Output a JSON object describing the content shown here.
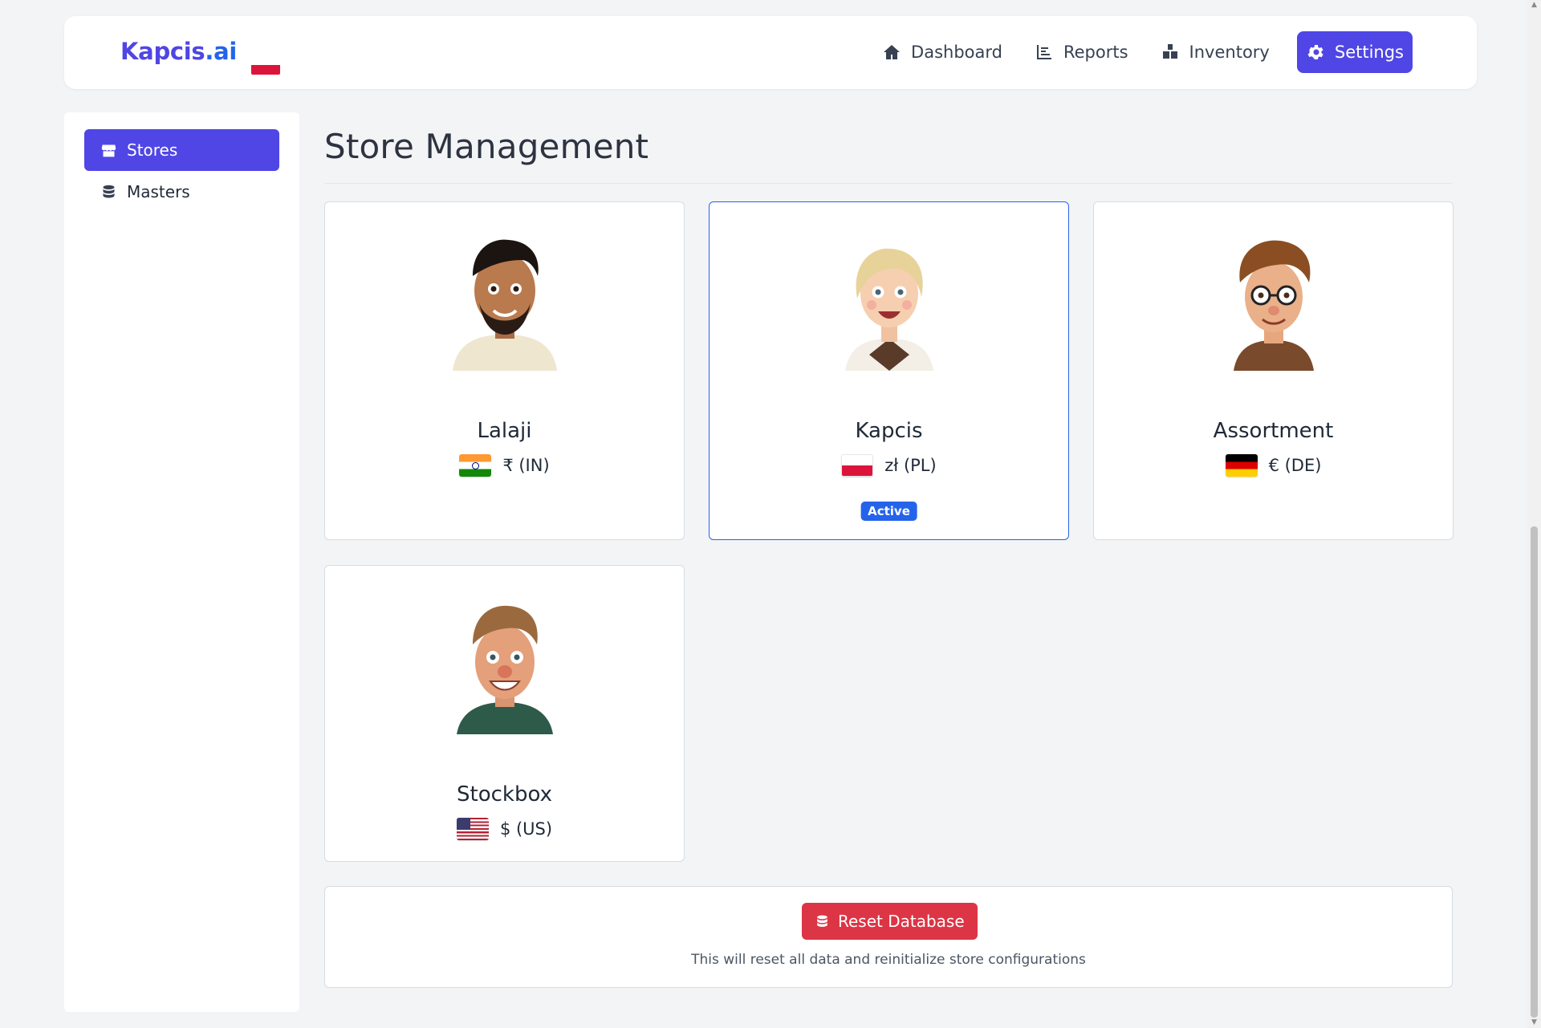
{
  "brand": {
    "name_part1": "Kapcis",
    "name_part2": ".ai",
    "flag_icon": "poland-flag-icon"
  },
  "nav": {
    "items": [
      {
        "label": "Dashboard",
        "icon": "home-icon"
      },
      {
        "label": "Reports",
        "icon": "bar-chart-icon"
      },
      {
        "label": "Inventory",
        "icon": "boxes-icon"
      },
      {
        "label": "Settings",
        "icon": "gear-icon",
        "active": true
      }
    ]
  },
  "sidebar": {
    "items": [
      {
        "label": "Stores",
        "icon": "store-icon",
        "active": true
      },
      {
        "label": "Masters",
        "icon": "database-icon"
      }
    ]
  },
  "main": {
    "title": "Store Management",
    "stores": [
      {
        "name": "Lalaji",
        "currency": "₹ (IN)",
        "flag": "india-flag-icon",
        "avatar": "man-with-beard-avatar"
      },
      {
        "name": "Kapcis",
        "currency": "zł (PL)",
        "flag": "poland-flag-icon",
        "avatar": "blonde-woman-avatar",
        "badge": "Active"
      },
      {
        "name": "Assortment",
        "currency": "€ (DE)",
        "flag": "germany-flag-icon",
        "avatar": "man-with-glasses-avatar"
      },
      {
        "name": "Stockbox",
        "currency": "$ (US)",
        "flag": "usa-flag-icon",
        "avatar": "smiling-man-avatar"
      }
    ],
    "reset": {
      "button_label": "Reset Database",
      "note": "This will reset all data and reinitialize store configurations"
    }
  },
  "colors": {
    "primary": "#4f46e5",
    "active_border": "#2563eb",
    "danger": "#dc3545",
    "background": "#f3f4f6"
  }
}
